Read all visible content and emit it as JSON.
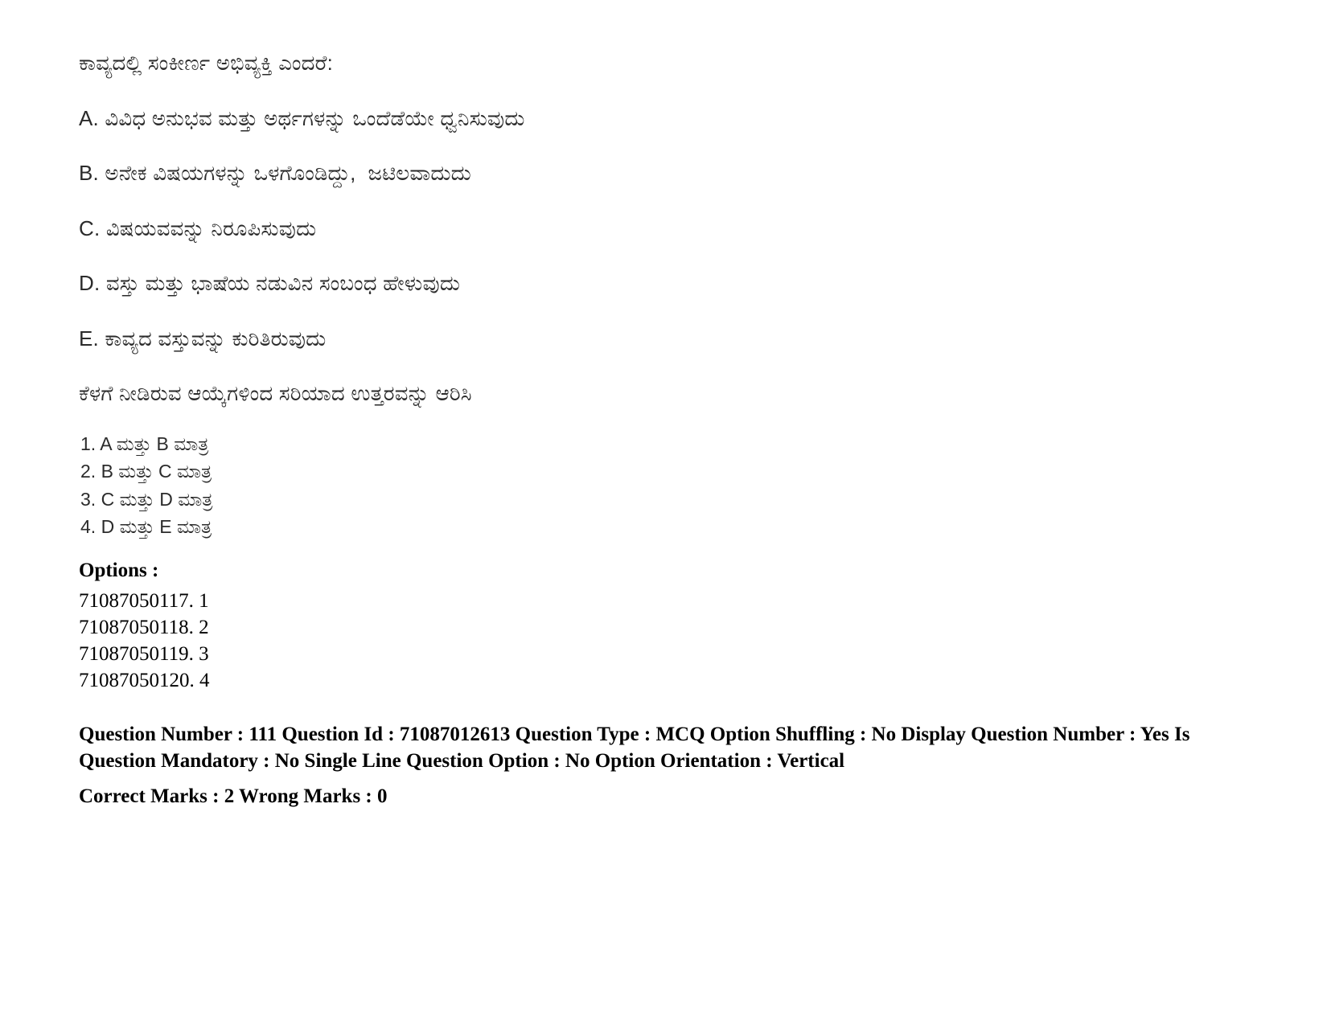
{
  "document": {
    "language": "Kannada",
    "background_color": "#ffffff",
    "text_color": "#000000"
  },
  "question": {
    "stem": "ಕಾವ್ಯದಲ್ಲಿ ಸಂಕೀರ್ಣ ಅಭಿವ್ಯಕ್ತಿ ಎಂದರೆ:",
    "statements": [
      "A. ವಿವಿಧ ಅನುಭವ ಮತ್ತು ಅರ್ಥಗಳನ್ನು ಒಂದೆಡೆಯೇ ಧ್ವನಿಸುವುದು",
      "B. ಅನೇಕ ವಿಷಯಗಳನ್ನು ಒಳಗೊಂಡಿದ್ದು,  ಜಟಿಲವಾದುದು",
      "C. ವಿಷಯವವನ್ನು ನಿರೂಪಿಸುವುದು",
      "D. ವಸ್ತು ಮತ್ತು ಭಾಷೆಯ ನಡುವಿನ ಸಂಬಂಧ ಹೇಳುವುದು",
      "E. ಕಾವ್ಯದ ವಸ್ತುವನ್ನು ಕುರಿತಿರುವುದು"
    ],
    "instruction": "ಕೆಳಗೆ ನೀಡಿರುವ ಆಯ್ಕೆಗಳಿಂದ ಸರಿಯಾದ ಉತ್ತರವನ್ನು ಆರಿಸಿ",
    "answer_choices": [
      "1. A ಮತ್ತು B ಮಾತ್ರ",
      "2. B ಮತ್ತು C ಮಾತ್ರ",
      "3. C ಮತ್ತು D ಮಾತ್ರ",
      "4. D ಮತ್ತು E ಮಾತ್ರ"
    ]
  },
  "options_section": {
    "heading": "Options :",
    "items": [
      "71087050117. 1",
      "71087050118. 2",
      "71087050119. 3",
      "71087050120. 4"
    ]
  },
  "metadata": {
    "line1": "Question Number : 111 Question Id : 71087012613 Question Type : MCQ Option Shuffling : No Display Question Number : Yes Is",
    "line2": "Question Mandatory : No Single Line Question Option : No Option Orientation : Vertical",
    "line3": "Correct Marks : 2 Wrong Marks : 0",
    "fields": {
      "question_number": "111",
      "question_id": "71087012613",
      "question_type": "MCQ",
      "option_shuffling": "No",
      "display_question_number": "Yes",
      "is_question_mandatory": "No",
      "single_line_question_option": "No",
      "option_orientation": "Vertical",
      "correct_marks": "2",
      "wrong_marks": "0"
    }
  }
}
